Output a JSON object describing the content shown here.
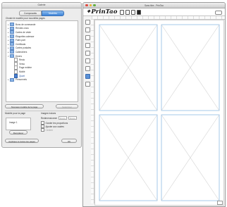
{
  "palette": {
    "title": "Galerie",
    "tabs": [
      {
        "label": "Composants",
        "active": false
      },
      {
        "label": "Modèles",
        "active": true
      }
    ],
    "tree_title": "Choisir le modèle pour nouvelles pages",
    "tree": [
      {
        "label": "Bons de commande",
        "indent": 0,
        "kind": "folder"
      },
      {
        "label": "Rendez-vous",
        "indent": 0,
        "kind": "folder"
      },
      {
        "label": "Cartes de visite",
        "indent": 0,
        "kind": "folder"
      },
      {
        "label": "Étiquettes adresse",
        "indent": 0,
        "kind": "folder"
      },
      {
        "label": "Faire-part",
        "indent": 0,
        "kind": "folder"
      },
      {
        "label": "Certificats",
        "indent": 0,
        "kind": "folder"
      },
      {
        "label": "Cartes postales",
        "indent": 0,
        "kind": "folder"
      },
      {
        "label": "Calendriers",
        "indent": 0,
        "kind": "folder"
      },
      {
        "label": "Divers",
        "indent": 0,
        "kind": "folder"
      },
      {
        "label": "Recto",
        "indent": 1,
        "kind": "doc"
      },
      {
        "label": "Verso",
        "indent": 1,
        "kind": "doc"
      },
      {
        "label": "Page entière",
        "indent": 1,
        "kind": "doc"
      },
      {
        "label": "Moitié",
        "indent": 1,
        "kind": "doc"
      },
      {
        "label": "Quart",
        "indent": 1,
        "kind": "doc",
        "selected": true
      },
      {
        "label": "Personnels",
        "indent": 0,
        "kind": "folder"
      }
    ],
    "new_template_button": "Nouveau modèle de la page",
    "delete_button": "Supprimer",
    "apply_label": "Modèle pour la page",
    "image_section_label": "Images inclues",
    "image_size_label": "Taille",
    "image_button": "Image 1",
    "resize_label": "Redimensionner",
    "field_placeholder": "0 mm",
    "checkbox_1": "Garder les proportions",
    "checkbox_2": "Ajuster aux cadres",
    "checkbox_3": "Centrer",
    "replace_button": "Remplacer",
    "apply_all_button": "Appliquer à toutes les pages",
    "ok_button": "OK"
  },
  "window": {
    "title": "Sans titre - PrinTao",
    "brand": "PrinTao",
    "lights": [
      "#e2473e",
      "#e9b02a",
      "#5fb03e"
    ],
    "accent": "#8ebbe3",
    "tb_icons": [
      "page-icon",
      "page-icon",
      "page-icon",
      "page-dark-icon"
    ]
  },
  "layout_panels": {
    "columns": 2,
    "rows": 2
  }
}
